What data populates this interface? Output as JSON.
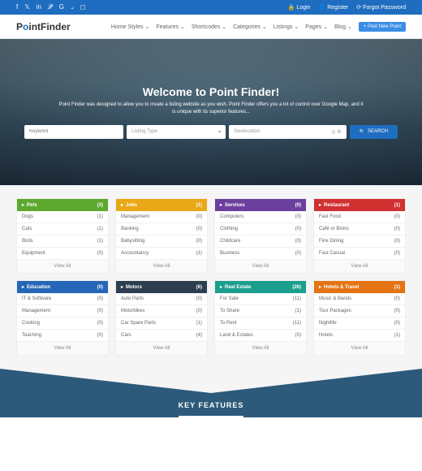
{
  "topbar": {
    "login": "Login",
    "register": "Register",
    "forgot": "Forgot Password"
  },
  "logo": {
    "p1": "P",
    "o": "o",
    "p2": "intFinder"
  },
  "nav": {
    "items": [
      "Home Styles ⌄",
      "Features ⌄",
      "Shortcodes ⌄",
      "Categories ⌄",
      "Listings ⌄",
      "Pages ⌄",
      "Blog ⌄"
    ],
    "post": "+ Post New Point"
  },
  "hero": {
    "title": "Welcome to Point Finder!",
    "subtitle": "Point Finder was designed to allow you to create a listing website as you wish. Point Finder offers you a lot of control over Google Map, and it is unique with its superior features...",
    "keyword_ph": "Keyword",
    "listing_type": "Listing Type",
    "geolocation": "Geolocation",
    "search": "SEARCH"
  },
  "cats": [
    {
      "name": "Pets",
      "count": "(3)",
      "color": "c-green",
      "items": [
        [
          "Dogs",
          "(1)"
        ],
        [
          "Cats",
          "(1)"
        ],
        [
          "Birds",
          "(1)"
        ],
        [
          "Equipment",
          "(0)"
        ]
      ]
    },
    {
      "name": "Jobs",
      "count": "(1)",
      "color": "c-yellow",
      "items": [
        [
          "Management",
          "(0)"
        ],
        [
          "Banking",
          "(0)"
        ],
        [
          "Babysitting",
          "(0)"
        ],
        [
          "Accountancy",
          "(1)"
        ]
      ]
    },
    {
      "name": "Services",
      "count": "(0)",
      "color": "c-purple",
      "items": [
        [
          "Computers",
          "(0)"
        ],
        [
          "Clothing",
          "(0)"
        ],
        [
          "Childcare",
          "(0)"
        ],
        [
          "Business",
          "(0)"
        ]
      ]
    },
    {
      "name": "Restaurant",
      "count": "(1)",
      "color": "c-red",
      "items": [
        [
          "Fast Food",
          "(0)"
        ],
        [
          "Café or Bistro",
          "(0)"
        ],
        [
          "Fine Dining",
          "(0)"
        ],
        [
          "Fast Casual",
          "(0)"
        ]
      ]
    },
    {
      "name": "Education",
      "count": "(0)",
      "color": "c-blue",
      "items": [
        [
          "IT & Software",
          "(0)"
        ],
        [
          "Management",
          "(0)"
        ],
        [
          "Cooking",
          "(0)"
        ],
        [
          "Teaching",
          "(0)"
        ]
      ]
    },
    {
      "name": "Motors",
      "count": "(6)",
      "color": "c-navy",
      "items": [
        [
          "Auto Parts",
          "(0)"
        ],
        [
          "Motorbikes",
          "(0)"
        ],
        [
          "Car Spare Parts",
          "(1)"
        ],
        [
          "Cars",
          "(4)"
        ]
      ]
    },
    {
      "name": "Real Estate",
      "count": "(26)",
      "color": "c-teal",
      "items": [
        [
          "For Sale",
          "(11)"
        ],
        [
          "To Share",
          "(1)"
        ],
        [
          "To Rent",
          "(11)"
        ],
        [
          "Land & Estates",
          "(0)"
        ]
      ]
    },
    {
      "name": "Hotels & Travel",
      "count": "(1)",
      "color": "c-orange",
      "items": [
        [
          "Music & Bands",
          "(0)"
        ],
        [
          "Tour Packages",
          "(0)"
        ],
        [
          "Nightlife",
          "(0)"
        ],
        [
          "Hotels",
          "(1)"
        ]
      ]
    }
  ],
  "viewall": "View All",
  "keyfeatures": "KEY FEATURES"
}
